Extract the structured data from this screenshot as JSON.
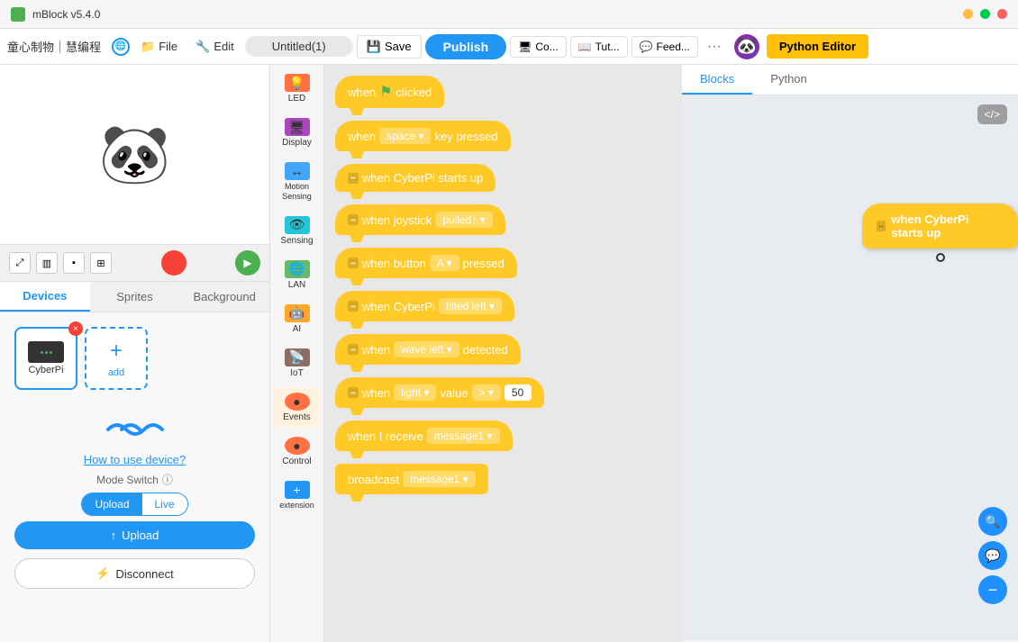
{
  "window": {
    "title": "mBlock v5.4.0",
    "min": "−",
    "max": "□",
    "close": "×"
  },
  "menubar": {
    "brand": "童心制物｜慧编程",
    "file": "File",
    "edit": "Edit",
    "project": "Untitled(1)",
    "save": "Save",
    "publish": "Publish",
    "connect": "Co...",
    "tutorial": "Tut...",
    "feedback": "Feed...",
    "more": "···",
    "python_editor": "Python Editor"
  },
  "left_panel": {
    "tabs": [
      "Devices",
      "Sprites",
      "Background"
    ],
    "active_tab": "Devices",
    "device_name": "CyberPi",
    "add_label": "add",
    "upload_link": "How to use device?",
    "mode_switch_label": "Mode Switch",
    "mode_upload": "Upload",
    "mode_live": "Live",
    "upload_btn": "Upload",
    "disconnect_btn": "Disconnect"
  },
  "palette": {
    "items": [
      {
        "id": "led",
        "label": "LED",
        "color": "#FF7043"
      },
      {
        "id": "display",
        "label": "Display",
        "color": "#AB47BC"
      },
      {
        "id": "motion",
        "label": "Motion\nSensing",
        "color": "#42A5F5"
      },
      {
        "id": "sensing",
        "label": "Sensing",
        "color": "#26C6DA"
      },
      {
        "id": "lan",
        "label": "LAN",
        "color": "#66BB6A"
      },
      {
        "id": "ai",
        "label": "AI",
        "color": "#FFA726"
      },
      {
        "id": "iot",
        "label": "IoT",
        "color": "#8D6E63"
      },
      {
        "id": "events",
        "label": "Events",
        "color": "#FF7043",
        "active": true
      },
      {
        "id": "control",
        "label": "Control",
        "color": "#FF7043"
      }
    ]
  },
  "blocks": [
    {
      "id": "when_clicked",
      "text": "when",
      "icon": "🏴",
      "suffix": "clicked",
      "type": "hat"
    },
    {
      "id": "when_key",
      "text": "when",
      "input": "space",
      "suffix": "key pressed",
      "type": "hat"
    },
    {
      "id": "when_cyberpi_starts",
      "text": "when CyberPi starts up",
      "type": "hat",
      "connector": true
    },
    {
      "id": "when_joystick",
      "text": "when joystick",
      "input": "pulled↑",
      "suffix": "",
      "type": "hat",
      "connector": true
    },
    {
      "id": "when_button",
      "text": "when button",
      "input": "A",
      "suffix": "pressed",
      "type": "hat",
      "connector": true
    },
    {
      "id": "when_cyberpi_tilted",
      "text": "when CyberPi",
      "input": "tilted left",
      "suffix": "",
      "type": "hat",
      "connector": true
    },
    {
      "id": "when_wave",
      "text": "when",
      "input": "wave left",
      "suffix": "detected",
      "type": "hat",
      "connector": true
    },
    {
      "id": "when_light",
      "text": "when",
      "input": "light",
      "suffix": "value",
      "operator": ">",
      "value": "50",
      "type": "hat",
      "connector": true
    },
    {
      "id": "when_receive",
      "text": "when I receive",
      "input": "message1",
      "type": "hat"
    },
    {
      "id": "broadcast",
      "text": "broadcast",
      "input": "message1",
      "type": "block"
    }
  ],
  "canvas": {
    "tabs": [
      "Blocks",
      "Python"
    ],
    "active_tab": "Blocks",
    "floating_block": "when CyberPi starts up"
  },
  "zoom": {
    "search": "🔍",
    "chat": "💬",
    "minus": "−"
  }
}
